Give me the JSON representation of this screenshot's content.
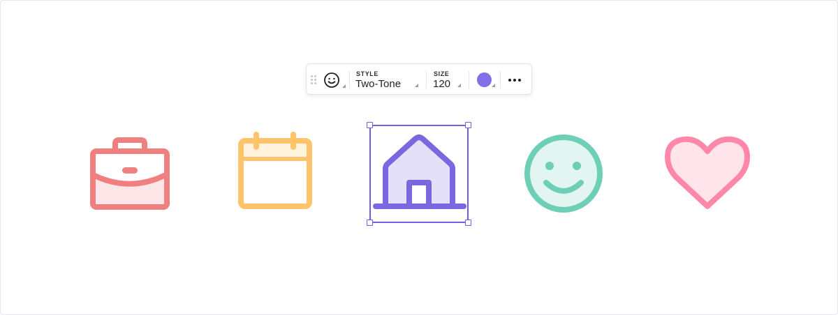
{
  "toolbar": {
    "icon_picker": "smiley-icon",
    "style": {
      "label": "STYLE",
      "value": "Two-Tone"
    },
    "size": {
      "label": "SIZE",
      "value": "120"
    },
    "color": "#8270e6",
    "more": "more-icon"
  },
  "icons": [
    {
      "name": "briefcase-icon",
      "stroke": "#f08080",
      "fill": "#fde6e8"
    },
    {
      "name": "calendar-icon",
      "stroke": "#fdc46c",
      "fill": "#fff3dc"
    },
    {
      "name": "home-icon",
      "stroke": "#7b68e0",
      "fill": "#e4e0f8",
      "selected": true
    },
    {
      "name": "smiley-icon",
      "stroke": "#6dcfb6",
      "fill": "#e2f5f1"
    },
    {
      "name": "heart-icon",
      "stroke": "#ff88aa",
      "fill": "#ffe4ec"
    }
  ]
}
